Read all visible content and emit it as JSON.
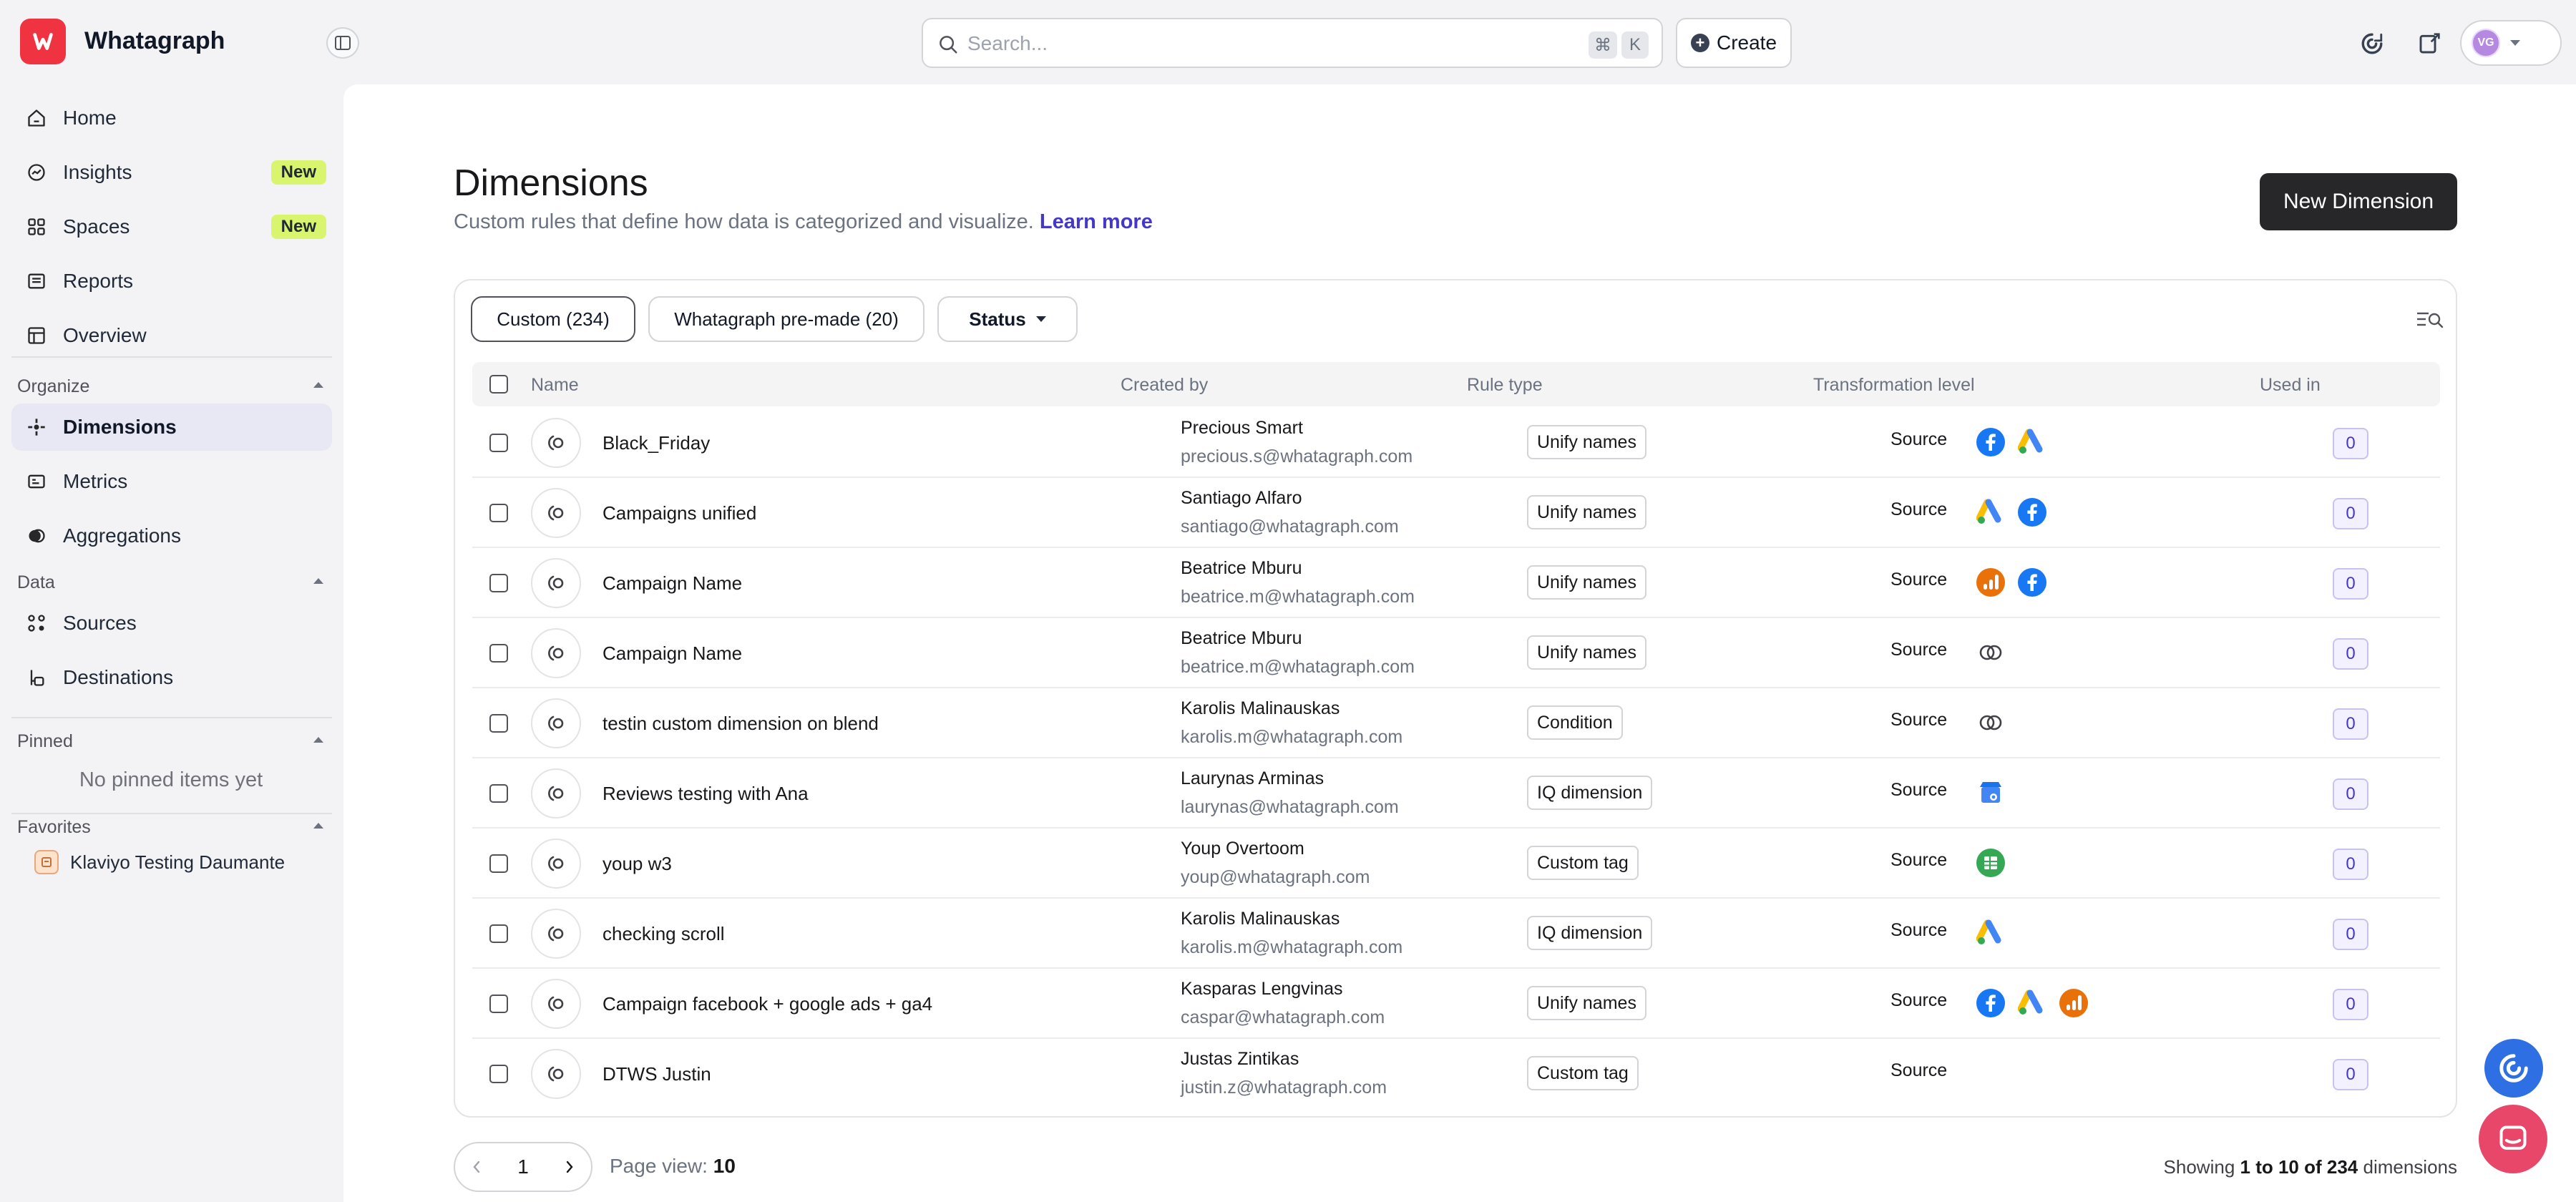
{
  "app": {
    "name": "Whatagraph"
  },
  "search": {
    "placeholder": "Search...",
    "kbd1": "⌘",
    "kbd2": "K"
  },
  "topbar": {
    "create_label": "Create",
    "avatar_initials": "VG"
  },
  "sidebar": {
    "items": [
      {
        "label": "Home"
      },
      {
        "label": "Insights",
        "badge": "New"
      },
      {
        "label": "Spaces",
        "badge": "New"
      },
      {
        "label": "Reports"
      },
      {
        "label": "Overview"
      }
    ],
    "organize_label": "Organize",
    "organize_items": [
      {
        "label": "Dimensions"
      },
      {
        "label": "Metrics"
      },
      {
        "label": "Aggregations"
      }
    ],
    "data_label": "Data",
    "data_items": [
      {
        "label": "Sources"
      },
      {
        "label": "Destinations"
      }
    ],
    "pinned_label": "Pinned",
    "pinned_empty": "No pinned items yet",
    "favorites_label": "Favorites",
    "favorites": [
      {
        "label": "Klaviyo Testing Daumante"
      }
    ]
  },
  "page": {
    "title": "Dimensions",
    "subtitle": "Custom rules that define how data is categorized and visualize.",
    "learn_more": "Learn more",
    "new_button": "New Dimension"
  },
  "filters": {
    "custom": "Custom (234)",
    "premade": "Whatagraph pre-made (20)",
    "status": "Status"
  },
  "table": {
    "columns": {
      "name": "Name",
      "created_by": "Created by",
      "rule_type": "Rule type",
      "transformation": "Transformation level",
      "used_in": "Used in"
    },
    "rows": [
      {
        "name": "Black_Friday",
        "creator": "Precious Smart",
        "email": "precious.s@whatagraph.com",
        "rule": "Unify names",
        "level": "Source",
        "sources": [
          "facebook-ads-icon",
          "google-ads-icon"
        ],
        "used": "0"
      },
      {
        "name": "Campaigns unified",
        "creator": "Santiago Alfaro",
        "email": "santiago@whatagraph.com",
        "rule": "Unify names",
        "level": "Source",
        "sources": [
          "google-ads-icon",
          "facebook-ads-icon"
        ],
        "used": "0"
      },
      {
        "name": "Campaign Name",
        "creator": "Beatrice Mburu",
        "email": "beatrice.m@whatagraph.com",
        "rule": "Unify names",
        "level": "Source",
        "sources": [
          "google-analytics-icon",
          "facebook-ads-icon"
        ],
        "used": "0"
      },
      {
        "name": "Campaign Name",
        "creator": "Beatrice Mburu",
        "email": "beatrice.m@whatagraph.com",
        "rule": "Unify names",
        "level": "Source",
        "sources": [
          "blend-icon"
        ],
        "used": "0"
      },
      {
        "name": "testin custom dimension on blend",
        "creator": "Karolis Malinauskas",
        "email": "karolis.m@whatagraph.com",
        "rule": "Condition",
        "level": "Source",
        "sources": [
          "blend-icon"
        ],
        "used": "0"
      },
      {
        "name": "Reviews testing with Ana",
        "creator": "Laurynas Arminas",
        "email": "laurynas@whatagraph.com",
        "rule": "IQ dimension",
        "level": "Source",
        "sources": [
          "google-business-icon"
        ],
        "used": "0"
      },
      {
        "name": "youp w3",
        "creator": "Youp Overtoom",
        "email": "youp@whatagraph.com",
        "rule": "Custom tag",
        "level": "Source",
        "sources": [
          "google-sheets-icon"
        ],
        "used": "0"
      },
      {
        "name": "checking scroll",
        "creator": "Karolis Malinauskas",
        "email": "karolis.m@whatagraph.com",
        "rule": "IQ dimension",
        "level": "Source",
        "sources": [
          "google-ads-icon"
        ],
        "used": "0"
      },
      {
        "name": "Campaign facebook + google ads + ga4",
        "creator": "Kasparas Lengvinas",
        "email": "caspar@whatagraph.com",
        "rule": "Unify names",
        "level": "Source",
        "sources": [
          "facebook-ads-icon",
          "google-ads-icon",
          "google-analytics-icon"
        ],
        "used": "0"
      },
      {
        "name": "DTWS Justin",
        "creator": "Justas Zintikas",
        "email": "justin.z@whatagraph.com",
        "rule": "Custom tag",
        "level": "Source",
        "sources": [],
        "used": "0"
      }
    ]
  },
  "pagination": {
    "current": "1",
    "page_view_label": "Page view:",
    "page_view_value": "10",
    "showing_prefix": "Showing",
    "showing_range": "1 to 10 of 234",
    "showing_suffix": "dimensions"
  },
  "colors": {
    "brand": "#ef3340",
    "accent": "#4338ca",
    "new_badge": "#d9f56e"
  }
}
